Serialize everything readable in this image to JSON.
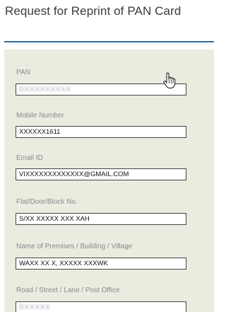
{
  "page": {
    "title": "Request for Reprint of PAN Card"
  },
  "form": {
    "fields": [
      {
        "label": "PAN",
        "value": "DXXXXXXXXX"
      },
      {
        "label": "Mobile Number",
        "value": "XXXXXX1611"
      },
      {
        "label": "Email ID",
        "value": "VIXXXXXXXXXXXXX@GMAIL.COM"
      },
      {
        "label": "Flat/Door/Block No.",
        "value": "S/XX XXXXX XXX XAH"
      },
      {
        "label": "Name of Premises / Building / Village",
        "value": "WAXX XX X, XXXXX XXXWK"
      },
      {
        "label": "Road / Street / Lane / Post Office",
        "value": "DXXXXX"
      }
    ]
  },
  "icons": {
    "cursor": "hand-pointer-icon"
  },
  "colors": {
    "panel_bg": "#ecebe0",
    "rule": "#2f6f9a"
  }
}
